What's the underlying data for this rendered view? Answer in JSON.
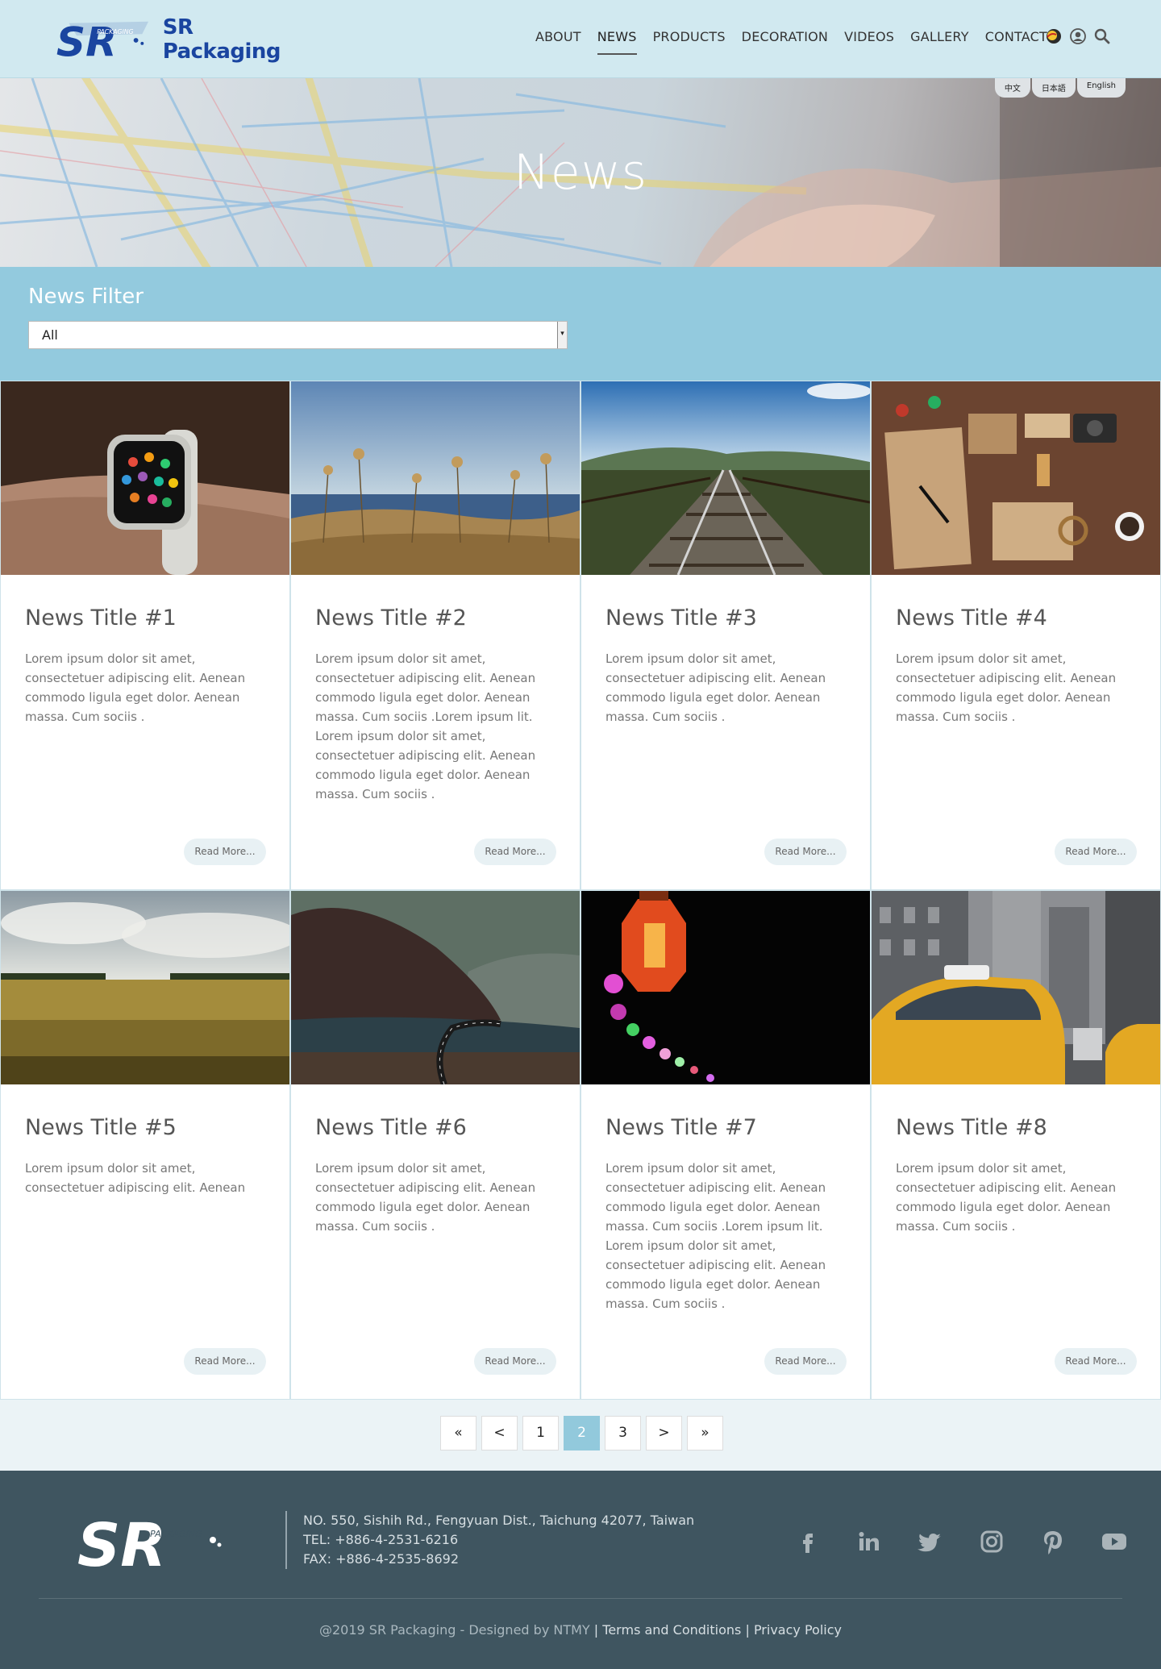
{
  "brand": {
    "name": "SR Packaging",
    "mark_text": "SR",
    "mark_sub": "PACKAGING",
    "color": "#1a45a0"
  },
  "nav": [
    {
      "label": "ABOUT",
      "active": false
    },
    {
      "label": "NEWS",
      "active": true
    },
    {
      "label": "PRODUCTS",
      "active": false
    },
    {
      "label": "DECORATION",
      "active": false
    },
    {
      "label": "VIDEOS",
      "active": false
    },
    {
      "label": "GALLERY",
      "active": false
    },
    {
      "label": "CONTACT",
      "active": false
    }
  ],
  "header_icons": [
    "chat-avatar-icon",
    "user-icon",
    "search-icon"
  ],
  "languages": [
    "中文",
    "日本語",
    "English"
  ],
  "hero": {
    "title": "News"
  },
  "filter": {
    "title": "News Filter",
    "selected": "All"
  },
  "cards": [
    {
      "title": "News Title #1",
      "text": "Lorem ipsum dolor sit amet, consectetuer adipiscing elit. Aenean commodo ligula eget dolor. Aenean massa. Cum sociis .",
      "button": "Read More...",
      "image": "smartwatch-on-wrist"
    },
    {
      "title": "News Title #2",
      "text": "Lorem ipsum dolor sit amet, consectetuer adipiscing elit. Aenean commodo ligula eget dolor. Aenean massa. Cum sociis .Lorem ipsum lit. Lorem ipsum dolor sit amet, consectetuer adipiscing elit. Aenean commodo ligula eget dolor. Aenean massa. Cum sociis .",
      "button": "Read More...",
      "image": "dry-flowers-by-sea"
    },
    {
      "title": "News Title #3",
      "text": "Lorem ipsum dolor sit amet, consectetuer adipiscing elit. Aenean commodo ligula eget dolor. Aenean massa. Cum sociis .",
      "button": "Read More...",
      "image": "railway-tracks"
    },
    {
      "title": "News Title #4",
      "text": "Lorem ipsum dolor sit amet, consectetuer adipiscing elit. Aenean commodo ligula eget dolor. Aenean massa. Cum sociis .",
      "button": "Read More...",
      "image": "craft-stationery-flatlay"
    },
    {
      "title": "News Title #5",
      "text": "Lorem ipsum dolor sit amet, consectetuer adipiscing elit. Aenean",
      "button": "Read More...",
      "image": "wheat-field"
    },
    {
      "title": "News Title #6",
      "text": "Lorem ipsum dolor sit amet, consectetuer adipiscing elit. Aenean commodo ligula eget dolor. Aenean massa. Cum sociis .",
      "button": "Read More...",
      "image": "mountain-road"
    },
    {
      "title": "News Title #7",
      "text": "Lorem ipsum dolor sit amet, consectetuer adipiscing elit. Aenean commodo ligula eget dolor. Aenean massa. Cum sociis .Lorem ipsum lit. Lorem ipsum dolor sit amet, consectetuer adipiscing elit. Aenean commodo ligula eget dolor. Aenean massa. Cum sociis .",
      "button": "Read More...",
      "image": "night-lanterns"
    },
    {
      "title": "News Title #8",
      "text": "Lorem ipsum dolor sit amet, consectetuer adipiscing elit. Aenean commodo ligula eget dolor. Aenean massa. Cum sociis .",
      "button": "Read More...",
      "image": "yellow-taxi-city"
    }
  ],
  "pagination": {
    "first": "«",
    "prev": "<",
    "pages": [
      "1",
      "2",
      "3"
    ],
    "current": "2",
    "next": ">",
    "last": "»"
  },
  "footer": {
    "address": "NO. 550, Sishih Rd., Fengyuan Dist., Taichung 42077, Taiwan",
    "tel": "TEL: +886-4-2531-6216",
    "fax": "FAX: +886-4-2535-8692",
    "social": [
      "facebook-icon",
      "linkedin-icon",
      "twitter-icon",
      "instagram-icon",
      "pinterest-icon",
      "youtube-icon"
    ],
    "copyright": "@2019 SR Packaging - Designed by",
    "designer": "NTMY",
    "separator": "|",
    "terms": "Terms and Conditions",
    "privacy": "Privacy Policy"
  },
  "colors": {
    "header_bg": "#d1e9f0",
    "filter_bg": "#93cade",
    "footer_bg": "#3f5560",
    "pager_active": "#92c9dc"
  }
}
